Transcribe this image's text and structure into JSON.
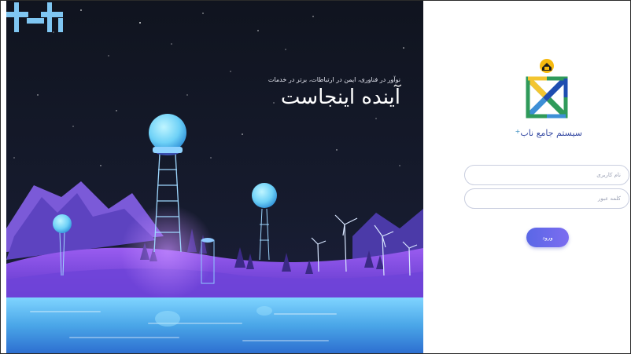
{
  "hero": {
    "tagline": "نوآور در فناوری، ایمن در ارتباطات، برتر در خدمات",
    "headline": "آینده اینجاست"
  },
  "system": {
    "title": "سیستم جامع ناب",
    "title_mark": "+"
  },
  "form": {
    "username_placeholder": "نام کاربری",
    "password_placeholder": "کلمه عبور",
    "login_label": "ورود"
  },
  "colors": {
    "accent": "#5a67e6",
    "hero_night": "#111624",
    "title_blue": "#364aa3"
  }
}
